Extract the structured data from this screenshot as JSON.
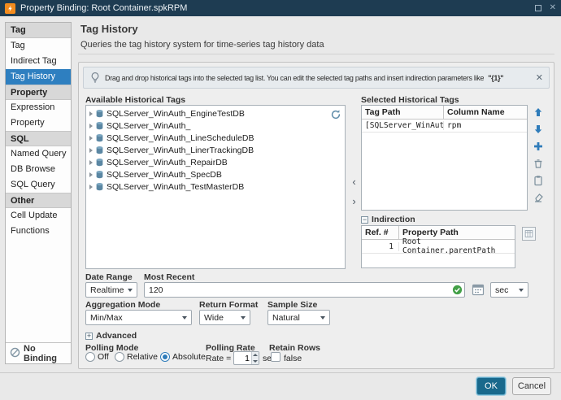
{
  "window": {
    "title": "Property Binding: Root Container.spkRPM"
  },
  "glyphs": {
    "close": "✕",
    "minus": "−",
    "plus": "+",
    "chevron_left": "‹",
    "chevron_right": "›"
  },
  "sidebar": {
    "sections": [
      {
        "header": "Tag",
        "items": [
          "Tag",
          "Indirect Tag",
          "Tag History"
        ]
      },
      {
        "header": "Property",
        "items": [
          "Expression",
          "Property"
        ]
      },
      {
        "header": "SQL",
        "items": [
          "Named Query",
          "DB Browse",
          "SQL Query"
        ]
      },
      {
        "header": "Other",
        "items": [
          "Cell Update",
          "Functions"
        ]
      }
    ],
    "selected_item": "Tag History",
    "no_binding": "No Binding"
  },
  "header": {
    "title": "Tag History",
    "subtitle": "Queries the tag history system for time-series tag history data"
  },
  "banner": {
    "text": "Drag and drop historical tags into the selected tag list. You can edit the selected tag paths and insert indirection parameters like",
    "param": "\"{1}\""
  },
  "available": {
    "label": "Available Historical Tags",
    "items": [
      "SQLServer_WinAuth_EngineTestDB",
      "SQLServer_WinAuth_",
      "SQLServer_WinAuth_LineScheduleDB",
      "SQLServer_WinAuth_LinerTrackingDB",
      "SQLServer_WinAuth_RepairDB",
      "SQLServer_WinAuth_SpecDB",
      "SQLServer_WinAuth_TestMasterDB"
    ]
  },
  "selected_tags": {
    "label": "Selected Historical Tags",
    "columns": [
      "Tag Path",
      "Column Name"
    ],
    "rows": [
      {
        "tag_path": "[SQLServer_WinAuth_",
        "column_name": "rpm"
      }
    ]
  },
  "indirection": {
    "label": "Indirection",
    "columns": [
      "Ref. #",
      "Property Path"
    ],
    "rows": [
      {
        "ref": "1",
        "path": "Root Container.parentPath"
      }
    ]
  },
  "date_range": {
    "label": "Date Range",
    "mode": "Realtime",
    "most_recent_label": "Most Recent",
    "most_recent_value": "120",
    "unit": "sec"
  },
  "aggregation": {
    "mode_label": "Aggregation Mode",
    "mode": "Min/Max",
    "return_format_label": "Return Format",
    "return_format": "Wide",
    "sample_size_label": "Sample Size",
    "sample_size": "Natural"
  },
  "advanced": {
    "label": "Advanced"
  },
  "polling": {
    "mode_label": "Polling Mode",
    "options": [
      "Off",
      "Relative",
      "Absolute"
    ],
    "selected_option": "Absolute",
    "rate_label": "Polling Rate",
    "rate_prefix": "Rate =",
    "rate_value": "1",
    "rate_unit": "sec",
    "retain_label": "Retain Rows",
    "retain_value": "false"
  },
  "footer": {
    "ok": "OK",
    "cancel": "Cancel"
  }
}
